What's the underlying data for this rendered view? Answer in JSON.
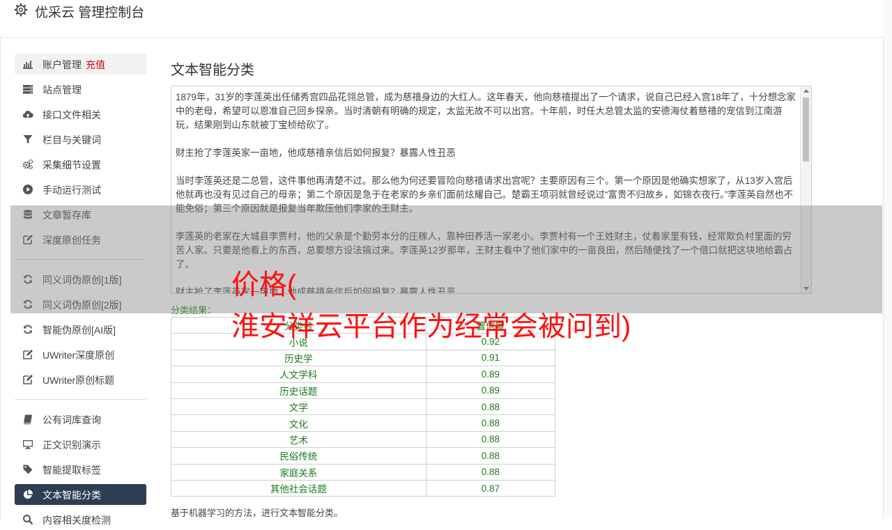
{
  "header": {
    "title": "优采云 管理控制台",
    "icon": "gear-icon"
  },
  "sidebar": {
    "items": [
      {
        "label": "账户管理",
        "extra": "充值",
        "icon": "bar-chart-icon"
      },
      {
        "label": "站点管理",
        "icon": "server-icon"
      },
      {
        "label": "接口文件相关",
        "icon": "cloud-upload-icon"
      },
      {
        "label": "栏目与关键词",
        "icon": "filter-icon"
      },
      {
        "label": "采集细节设置",
        "icon": "cogs-icon"
      },
      {
        "label": "手动运行测试",
        "icon": "play-circle-icon"
      },
      {
        "label": "文章暂存库",
        "icon": "database-icon"
      },
      {
        "label": "深度原创任务",
        "icon": "edit-icon"
      },
      {
        "label": "同义词伪原创[1版]",
        "icon": "refresh-icon"
      },
      {
        "label": "同义词伪原创[2版]",
        "icon": "refresh-icon"
      },
      {
        "label": "智能伪原创[AI版]",
        "icon": "refresh-icon"
      },
      {
        "label": "UWriter深度原创",
        "icon": "edit-icon"
      },
      {
        "label": "UWriter原创标题",
        "icon": "edit-icon"
      },
      {
        "label": "公有词库查询",
        "icon": "book-icon"
      },
      {
        "label": "正文识别演示",
        "icon": "monitor-icon"
      },
      {
        "label": "智能提取标签",
        "icon": "tag-icon"
      },
      {
        "label": "文本智能分类",
        "icon": "pie-chart-icon"
      },
      {
        "label": "内容相关度检测",
        "icon": "search-icon"
      }
    ]
  },
  "main": {
    "title": "文本智能分类",
    "text_paragraphs": [
      "1879年，31岁的李莲英出任储秀宫四品花翎总管，成为慈禧身边的大红人。这年春天，他向慈禧提出了一个请求，说自己已经入宫18年了，十分想念家中的老母，希望可以恩准自己回乡探亲。当时清朝有明确的规定，太监无故不可以出宫。十年前，时任大总管太监的安德海仗着慈禧的宠信到江南游玩，结果刚到山东就被丁宝桢给砍了。",
      "财主抢了李莲英家一亩地，他成慈禧亲信后如何报复？暴露人性丑恶",
      "当时李莲英还是二总管，这件事他再清楚不过。那么他为何还要冒险向慈禧请求出宫呢？主要原因有三个。第一个原因是他确实想家了，从13岁入宫后他就再也没有见过自己的母亲；第二个原因是急于在老家的乡亲们面前炫耀自己。楚霸王项羽就曾经说过“富贵不归故乡，如锦衣夜行。”李莲英自然也不能免俗；第三个原因就是报复当年欺压他们李家的王财主。",
      "李莲英的老家在大城县李贾村，他的父亲是个勤劳本分的庄稼人，靠种田养活一家老小。李贾村有一个王姓财主，仗着家里有钱，经常欺负村里面的穷苦人家。只要是他看上的东西，总要想方设法搞过来。李莲英12岁那年，王财主看中了他们家中的一亩良田，然后随便找了一个借口就把这块地给霸占了。",
      "财主抢了李莲英家一亩地，他成慈禧亲信后如何报复？暴露人性丑恶"
    ],
    "result_label": "分类结果：",
    "table": {
      "headers": [
        "分类名",
        "置信度"
      ],
      "rows": [
        [
          "小说",
          "0.92"
        ],
        [
          "历史学",
          "0.91"
        ],
        [
          "人文学科",
          "0.89"
        ],
        [
          "历史话题",
          "0.89"
        ],
        [
          "文学",
          "0.88"
        ],
        [
          "文化",
          "0.88"
        ],
        [
          "艺术",
          "0.88"
        ],
        [
          "民俗传统",
          "0.88"
        ],
        [
          "家庭关系",
          "0.88"
        ],
        [
          "其他社会话题",
          "0.87"
        ]
      ]
    },
    "footer_note": "基于机器学习的方法，进行文本智能分类。"
  },
  "overlay": {
    "line1": "价格(",
    "line2": "淮安祥云平台作为经常会被问到)"
  }
}
